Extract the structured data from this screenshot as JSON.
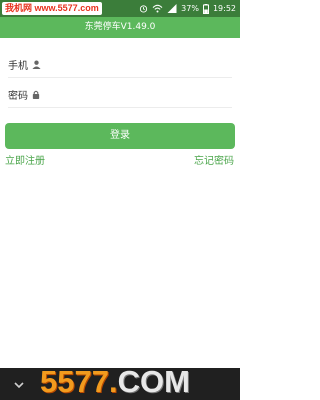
{
  "status_bar": {
    "watermark": "我机网 www.5577.com",
    "battery": "37%",
    "time": "19:52"
  },
  "app_bar": {
    "title": "东莞停车V1.49.0"
  },
  "form": {
    "phone_label": "手机",
    "password_label": "密码",
    "login_button": "登录",
    "register_link": "立即注册",
    "forgot_link": "忘记密码"
  },
  "bottom": {
    "watermark_main": "5577.",
    "watermark_com": "COM"
  },
  "colors": {
    "accent": "#5cb85c",
    "status_bar": "#3b7d3a",
    "link": "#4aa54a"
  }
}
